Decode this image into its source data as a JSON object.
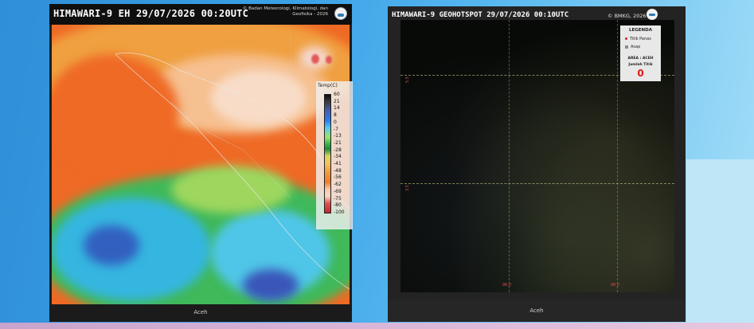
{
  "left_panel": {
    "title": "HIMAWARI-9 EH  29/07/2026  00:20UTC",
    "credit": "© Badan Meteorologi, Klimatologi, dan Geofisika - 2026",
    "legend_title": "Temp(C)",
    "legend_ticks": [
      "60",
      "21",
      "14",
      "8",
      "0",
      "-7",
      "-13",
      "-21",
      "-28",
      "-34",
      "-41",
      "-48",
      "-56",
      "-62",
      "-69",
      "-75",
      "-80",
      "-100"
    ],
    "footer_label": "Aceh"
  },
  "right_panel": {
    "title": "HIMAWARI-9 GEOHOTSPOT  29/07/2026  00:10UTC",
    "credit": "© BMKG, 2026",
    "legend": {
      "title": "LEGENDA",
      "item_hotspot": "Titik Panas",
      "item_smoke": "Asap",
      "area_label": "AREA : ACEH",
      "count_label": "Jumlah Titik",
      "count_value": "0"
    },
    "lat_labels": [
      "5.5",
      "3.5"
    ],
    "lon_labels": [
      "96.0",
      "98.0"
    ],
    "footer_label": "Aceh"
  },
  "colors": {
    "hotspot_red": "#e02020",
    "count_red": "#e01818",
    "map_orange": "#ef6a25"
  }
}
